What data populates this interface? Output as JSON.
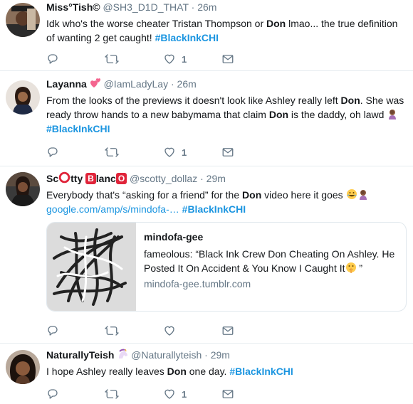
{
  "tweets": [
    {
      "name": "Miss°Tish©",
      "handle": "@SH3_D1D_THAT",
      "dot": "·",
      "time": "26m",
      "text": {
        "a": "Idk who's the worse cheater Tristan Thompson or ",
        "b": "Don",
        "c": " lmao... the true definition of wanting 2 get caught! ",
        "hashtag": "#BlackInkCHI"
      },
      "like_count": "1"
    },
    {
      "name": "Layanna",
      "handle": "@IamLadyLay",
      "dot": "·",
      "time": "26m",
      "text": {
        "a": "From the looks of the previews it doesn't look like Ashley really left ",
        "b": "Don",
        "c": ". She was ready throw hands to a new babymama that claim ",
        "d": "Don",
        "e": " is the daddy, oh lawd ",
        "hashtag": "#BlackInkCHI"
      },
      "like_count": "1"
    },
    {
      "name_parts": [
        "Sc",
        "tty ",
        "B",
        "lanc",
        "O"
      ],
      "handle": "@scotty_dollaz",
      "dot": "·",
      "time": "29m",
      "text": {
        "a": "Everybody that's “asking for a friend” for the ",
        "b": "Don",
        "c": " video here it goes ",
        "link": "google.com/amp/s/mindofa-…",
        "hashtag": "#BlackInkCHI"
      },
      "card": {
        "title": "mindofa-gee",
        "description": "fameolous: “Black Ink Crew Don Cheating On Ashley. He Posted It On Accident & You Know I Caught It",
        "description_end": " ”",
        "domain": "mindofa-gee.tumblr.com"
      }
    },
    {
      "name": "NaturallyTeish",
      "handle": "@Naturallyteish",
      "dot": "·",
      "time": "29m",
      "text": {
        "a": "I hope Ashley really leaves ",
        "b": "Don",
        "c": " one day. ",
        "hashtag": "#BlackInkCHI"
      },
      "like_count": "1"
    }
  ],
  "icons": {
    "reply": "reply-icon",
    "retweet": "retweet-icon",
    "like": "heart-icon",
    "dm": "envelope-icon"
  },
  "colors": {
    "link": "#1b95e0",
    "muted": "#657786",
    "text": "#14171a",
    "border": "#e6ecf0"
  }
}
